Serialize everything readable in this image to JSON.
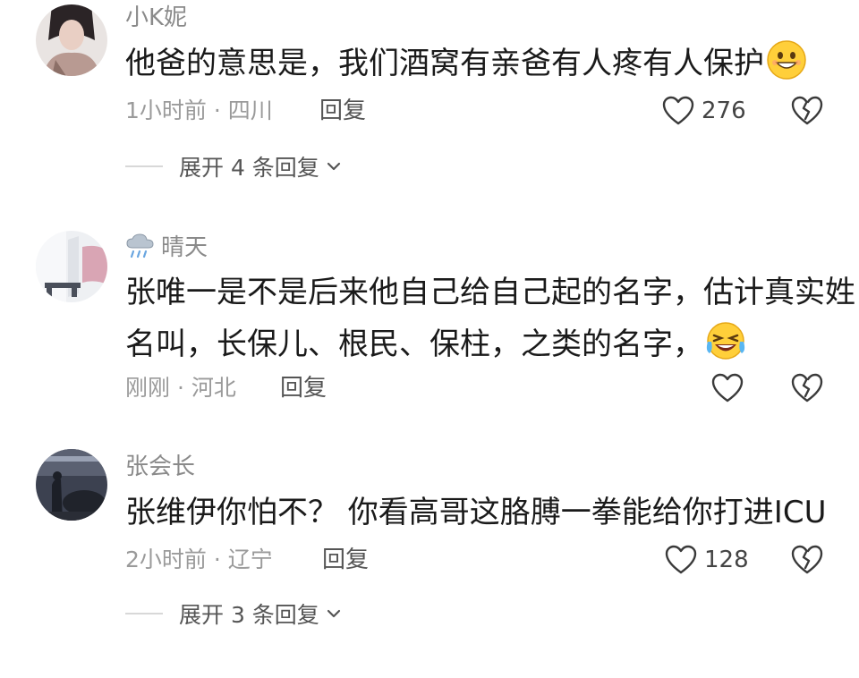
{
  "comments": [
    {
      "username": "小K妮",
      "text_lines": [
        "他爸的意思是，我们酒窝有亲爸有人疼有人保护"
      ],
      "emoji": "grinning-face",
      "time": "1小时前",
      "location": "四川",
      "reply_label": "回复",
      "likes": "276",
      "expand_label": "展开 4 条回复"
    },
    {
      "username": "晴天",
      "username_icon": "rain-cloud-icon",
      "text_lines": [
        "张唯一是不是后来他自己给自己起的名字，估计真实姓",
        "名叫，长保儿、根民、保柱，之类的名字，"
      ],
      "emoji": "laughing-crying-face",
      "time": "刚刚",
      "location": "河北",
      "reply_label": "回复"
    },
    {
      "username": "张会长",
      "text_lines": [
        "张维伊你怕不？ 你看高哥这胳膊一拳能给你打进ICU"
      ],
      "time": "2小时前",
      "location": "辽宁",
      "reply_label": "回复",
      "likes": "128",
      "expand_label": "展开 3 条回复"
    }
  ],
  "separator": " · ",
  "colors": {
    "text": "#1a1a1a",
    "meta": "#9a9a9a",
    "username": "#8a8a8a",
    "icon": "#3a3a3a"
  }
}
